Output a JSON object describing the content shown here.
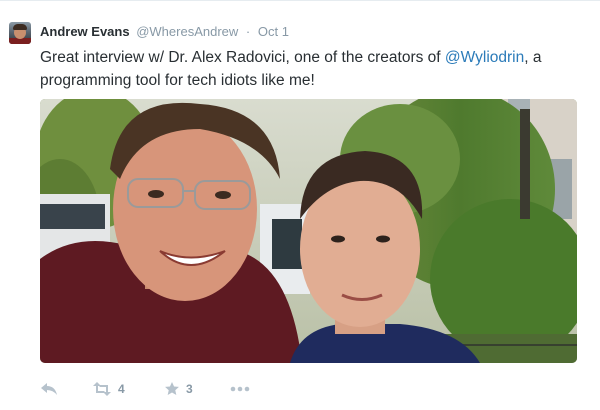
{
  "tweet": {
    "author": {
      "display_name": "Andrew Evans",
      "handle": "@WheresAndrew",
      "separator": "·",
      "date": "Oct 1"
    },
    "text": {
      "part1": "Great interview w/ Dr. Alex Radovici, one of the creators of ",
      "mention": "@Wyliodrin",
      "part2": ", a programming tool for tech idiots like me!"
    },
    "actions": {
      "reply_icon": "reply-icon",
      "retweet_icon": "retweet-icon",
      "retweet_count": "4",
      "favorite_icon": "star-icon",
      "favorite_count": "3",
      "more_icon": "more-dots-icon"
    },
    "colors": {
      "link": "#2b7bb9",
      "meta": "#8899a6",
      "text": "#292f33"
    }
  }
}
